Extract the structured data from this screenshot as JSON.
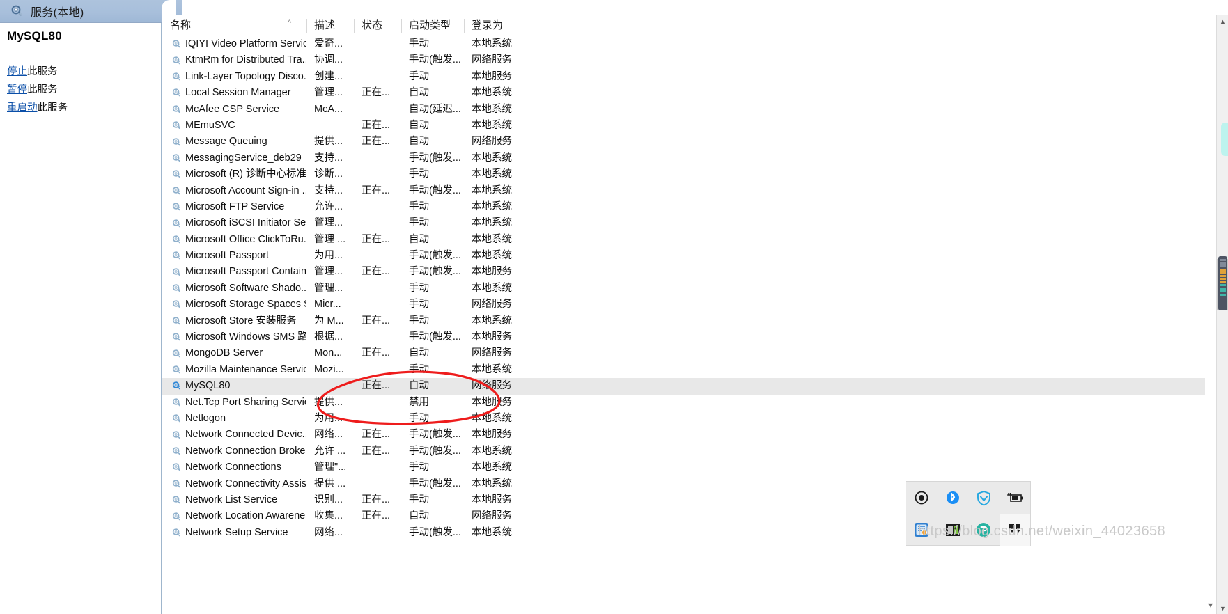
{
  "left_pane": {
    "titlebar": {
      "icon": "services-gear-icon",
      "title": "服务(本地)"
    },
    "service_name": "MySQL80",
    "actions": [
      {
        "link": "停止",
        "rest": "此服务"
      },
      {
        "link": "暂停",
        "rest": "此服务"
      },
      {
        "link": "重启动",
        "rest": "此服务"
      }
    ]
  },
  "listview": {
    "sort_indicator": "^",
    "columns": [
      {
        "key": "name",
        "label": "名称"
      },
      {
        "key": "desc",
        "label": "描述"
      },
      {
        "key": "state",
        "label": "状态"
      },
      {
        "key": "start",
        "label": "启动类型"
      },
      {
        "key": "logon",
        "label": "登录为"
      }
    ],
    "rows": [
      {
        "name": "IQIYI Video Platform Service",
        "desc": "爱奇...",
        "state": "",
        "start": "手动",
        "logon": "本地系统",
        "selected": false
      },
      {
        "name": "KtmRm for Distributed Tra...",
        "desc": "协调...",
        "state": "",
        "start": "手动(触发...",
        "logon": "网络服务",
        "selected": false
      },
      {
        "name": "Link-Layer Topology Disco...",
        "desc": "创建...",
        "state": "",
        "start": "手动",
        "logon": "本地服务",
        "selected": false
      },
      {
        "name": "Local Session Manager",
        "desc": "管理...",
        "state": "正在...",
        "start": "自动",
        "logon": "本地系统",
        "selected": false
      },
      {
        "name": "McAfee CSP Service",
        "desc": "McA...",
        "state": "",
        "start": "自动(延迟...",
        "logon": "本地系统",
        "selected": false
      },
      {
        "name": "MEmuSVC",
        "desc": "",
        "state": "正在...",
        "start": "自动",
        "logon": "本地系统",
        "selected": false
      },
      {
        "name": "Message Queuing",
        "desc": "提供...",
        "state": "正在...",
        "start": "自动",
        "logon": "网络服务",
        "selected": false
      },
      {
        "name": "MessagingService_deb29",
        "desc": "支持...",
        "state": "",
        "start": "手动(触发...",
        "logon": "本地系统",
        "selected": false
      },
      {
        "name": "Microsoft (R) 诊断中心标准...",
        "desc": "诊断...",
        "state": "",
        "start": "手动",
        "logon": "本地系统",
        "selected": false
      },
      {
        "name": "Microsoft Account Sign-in ...",
        "desc": "支持...",
        "state": "正在...",
        "start": "手动(触发...",
        "logon": "本地系统",
        "selected": false
      },
      {
        "name": "Microsoft FTP Service",
        "desc": "允许...",
        "state": "",
        "start": "手动",
        "logon": "本地系统",
        "selected": false
      },
      {
        "name": "Microsoft iSCSI Initiator Ser...",
        "desc": "管理...",
        "state": "",
        "start": "手动",
        "logon": "本地系统",
        "selected": false
      },
      {
        "name": "Microsoft Office ClickToRu...",
        "desc": "管理 ...",
        "state": "正在...",
        "start": "自动",
        "logon": "本地系统",
        "selected": false
      },
      {
        "name": "Microsoft Passport",
        "desc": "为用...",
        "state": "",
        "start": "手动(触发...",
        "logon": "本地系统",
        "selected": false
      },
      {
        "name": "Microsoft Passport Container",
        "desc": "管理...",
        "state": "正在...",
        "start": "手动(触发...",
        "logon": "本地服务",
        "selected": false
      },
      {
        "name": "Microsoft Software Shado...",
        "desc": "管理...",
        "state": "",
        "start": "手动",
        "logon": "本地系统",
        "selected": false
      },
      {
        "name": "Microsoft Storage Spaces S...",
        "desc": "Micr...",
        "state": "",
        "start": "手动",
        "logon": "网络服务",
        "selected": false
      },
      {
        "name": "Microsoft Store 安装服务",
        "desc": "为 M...",
        "state": "正在...",
        "start": "手动",
        "logon": "本地系统",
        "selected": false
      },
      {
        "name": "Microsoft Windows SMS 路...",
        "desc": "根据...",
        "state": "",
        "start": "手动(触发...",
        "logon": "本地服务",
        "selected": false
      },
      {
        "name": "MongoDB Server",
        "desc": "Mon...",
        "state": "正在...",
        "start": "自动",
        "logon": "网络服务",
        "selected": false
      },
      {
        "name": "Mozilla Maintenance Service",
        "desc": "Mozi...",
        "state": "",
        "start": "手动",
        "logon": "本地系统",
        "selected": false
      },
      {
        "name": "MySQL80",
        "desc": "",
        "state": "正在...",
        "start": "自动",
        "logon": "网络服务",
        "selected": true
      },
      {
        "name": "Net.Tcp Port Sharing Service",
        "desc": "提供...",
        "state": "",
        "start": "禁用",
        "logon": "本地服务",
        "selected": false
      },
      {
        "name": "Netlogon",
        "desc": "为用...",
        "state": "",
        "start": "手动",
        "logon": "本地系统",
        "selected": false
      },
      {
        "name": "Network Connected Devic...",
        "desc": "网络...",
        "state": "正在...",
        "start": "手动(触发...",
        "logon": "本地服务",
        "selected": false
      },
      {
        "name": "Network Connection Broker",
        "desc": "允许 ...",
        "state": "正在...",
        "start": "手动(触发...",
        "logon": "本地系统",
        "selected": false
      },
      {
        "name": "Network Connections",
        "desc": "管理\"...",
        "state": "",
        "start": "手动",
        "logon": "本地系统",
        "selected": false
      },
      {
        "name": "Network Connectivity Assis...",
        "desc": "提供 ...",
        "state": "",
        "start": "手动(触发...",
        "logon": "本地系统",
        "selected": false
      },
      {
        "name": "Network List Service",
        "desc": "识别...",
        "state": "正在...",
        "start": "手动",
        "logon": "本地服务",
        "selected": false
      },
      {
        "name": "Network Location Awarene...",
        "desc": "收集...",
        "state": "正在...",
        "start": "自动",
        "logon": "网络服务",
        "selected": false
      },
      {
        "name": "Network Setup Service",
        "desc": "网络...",
        "state": "",
        "start": "手动(触发...",
        "logon": "本地系统",
        "selected": false
      }
    ]
  },
  "scrollbar": {
    "up_arrow": "▲",
    "down_arrow": "▼"
  },
  "annotation": {
    "shape": "red-hand-drawn-ellipse",
    "color": "#ee1c1c",
    "target_row": "MySQL80"
  },
  "tray": {
    "icons_row1": [
      "record-icon",
      "bluetooth-icon",
      "tencent-shield-icon",
      "battery-charging-icon"
    ],
    "icons_row2": [
      "wechat-app-icon",
      "screenshot-app-icon",
      "qq-music-icon",
      "show-hidden-icons-icon"
    ]
  },
  "watermark": {
    "text": "https://blog.csdn.net/weixin_44023658"
  },
  "colors": {
    "titlebar": "#a8bfdb",
    "link": "#0b4fa8",
    "selected_row": "#e8e8e8",
    "annotation_red": "#ee1c1c"
  }
}
